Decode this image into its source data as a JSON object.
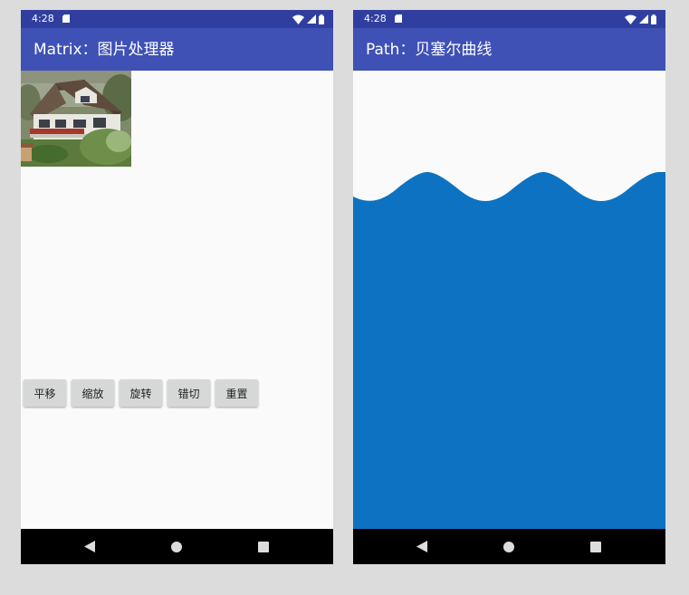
{
  "left_screen": {
    "status": {
      "time": "4:28"
    },
    "appbar": {
      "title": "Matrix：图片处理器"
    },
    "buttons": [
      "平移",
      "缩放",
      "旋转",
      "错切",
      "重置"
    ]
  },
  "right_screen": {
    "status": {
      "time": "4:28"
    },
    "appbar": {
      "title": "Path：贝塞尔曲线"
    }
  },
  "colors": {
    "status_bar": "#303f9f",
    "app_bar": "#3f51b5",
    "wave": "#0d72c1",
    "content_bg": "#fafafa",
    "button_bg": "#d6d7d7"
  }
}
